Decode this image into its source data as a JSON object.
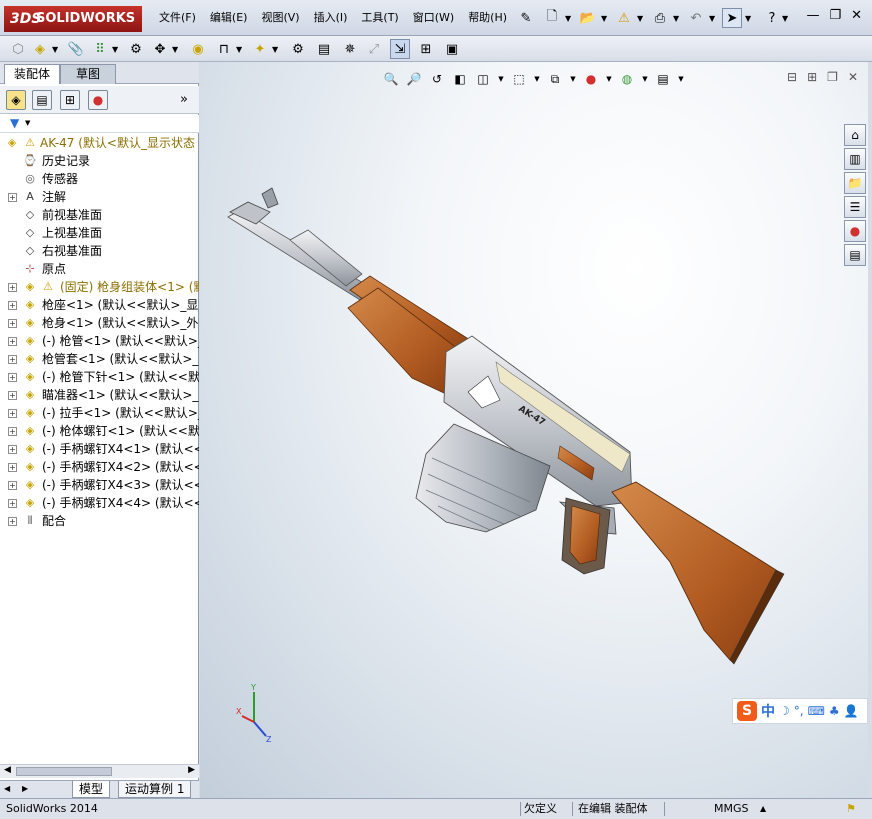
{
  "app": {
    "logo_ds": "3DS",
    "logo_text": "SOLIDWORKS"
  },
  "menu": [
    "文件(F)",
    "编辑(E)",
    "视图(V)",
    "插入(I)",
    "工具(T)",
    "窗口(W)",
    "帮助(H)"
  ],
  "tabs": {
    "assembly": "装配体",
    "sketch": "草图"
  },
  "tree": [
    {
      "label": "AK-47  (默认<默认_显示状态",
      "color": "#8b6f00",
      "icon": "assembly-warning-icon",
      "expander": false
    },
    {
      "label": "历史记录",
      "color": "#000",
      "icon": "history-icon",
      "expander": false
    },
    {
      "label": "传感器",
      "color": "#000",
      "icon": "sensor-icon",
      "expander": false
    },
    {
      "label": "注解",
      "color": "#000",
      "icon": "annotation-icon",
      "expander": true
    },
    {
      "label": "前视基准面",
      "color": "#000",
      "icon": "plane-icon",
      "expander": false
    },
    {
      "label": "上视基准面",
      "color": "#000",
      "icon": "plane-icon",
      "expander": false
    },
    {
      "label": "右视基准面",
      "color": "#000",
      "icon": "plane-icon",
      "expander": false
    },
    {
      "label": "原点",
      "color": "#000",
      "icon": "origin-icon",
      "expander": false
    },
    {
      "label": "(固定) 枪身组装体<1> (默",
      "color": "#8b6f00",
      "icon": "subassembly-warning-icon",
      "expander": true
    },
    {
      "label": "枪座<1> (默认<<默认>_显示",
      "color": "#000",
      "icon": "part-icon",
      "expander": true
    },
    {
      "label": "枪身<1> (默认<<默认>_外观",
      "color": "#000",
      "icon": "part-icon",
      "expander": true
    },
    {
      "label": "(-) 枪管<1> (默认<<默认>_显",
      "color": "#000",
      "icon": "part-icon",
      "expander": true
    },
    {
      "label": "枪管套<1> (默认<<默认>_显示",
      "color": "#000",
      "icon": "part-icon",
      "expander": true
    },
    {
      "label": "(-) 枪管下针<1> (默认<<默认",
      "color": "#000",
      "icon": "part-icon",
      "expander": true
    },
    {
      "label": "瞄准器<1> (默认<<默认>_外观",
      "color": "#000",
      "icon": "part-icon",
      "expander": true
    },
    {
      "label": "(-) 拉手<1> (默认<<默认>_显",
      "color": "#000",
      "icon": "part-icon",
      "expander": true
    },
    {
      "label": "(-) 枪体螺钉<1> (默认<<默认",
      "color": "#000",
      "icon": "part-icon",
      "expander": true
    },
    {
      "label": "(-) 手柄螺钉X4<1> (默认<<默",
      "color": "#000",
      "icon": "part-icon",
      "expander": true
    },
    {
      "label": "(-) 手柄螺钉X4<2> (默认<<默",
      "color": "#000",
      "icon": "part-icon",
      "expander": true
    },
    {
      "label": "(-) 手柄螺钉X4<3> (默认<<默",
      "color": "#000",
      "icon": "part-icon",
      "expander": true
    },
    {
      "label": "(-) 手柄螺钉X4<4> (默认<<默",
      "color": "#000",
      "icon": "part-icon",
      "expander": true
    },
    {
      "label": "配合",
      "color": "#000",
      "icon": "mates-icon",
      "expander": true
    }
  ],
  "bottom_tabs": {
    "model": "模型",
    "motion": "运动算例 1"
  },
  "model_label": "AK-47",
  "ime": {
    "lang": "中"
  },
  "status": {
    "version": "SolidWorks 2014",
    "under_defined": "欠定义",
    "editing": "在编辑 装配体",
    "units": "MMGS"
  },
  "colors": {
    "wood": "#b8652a",
    "metal": "#c8ccd2",
    "accent": "#c5332b"
  }
}
